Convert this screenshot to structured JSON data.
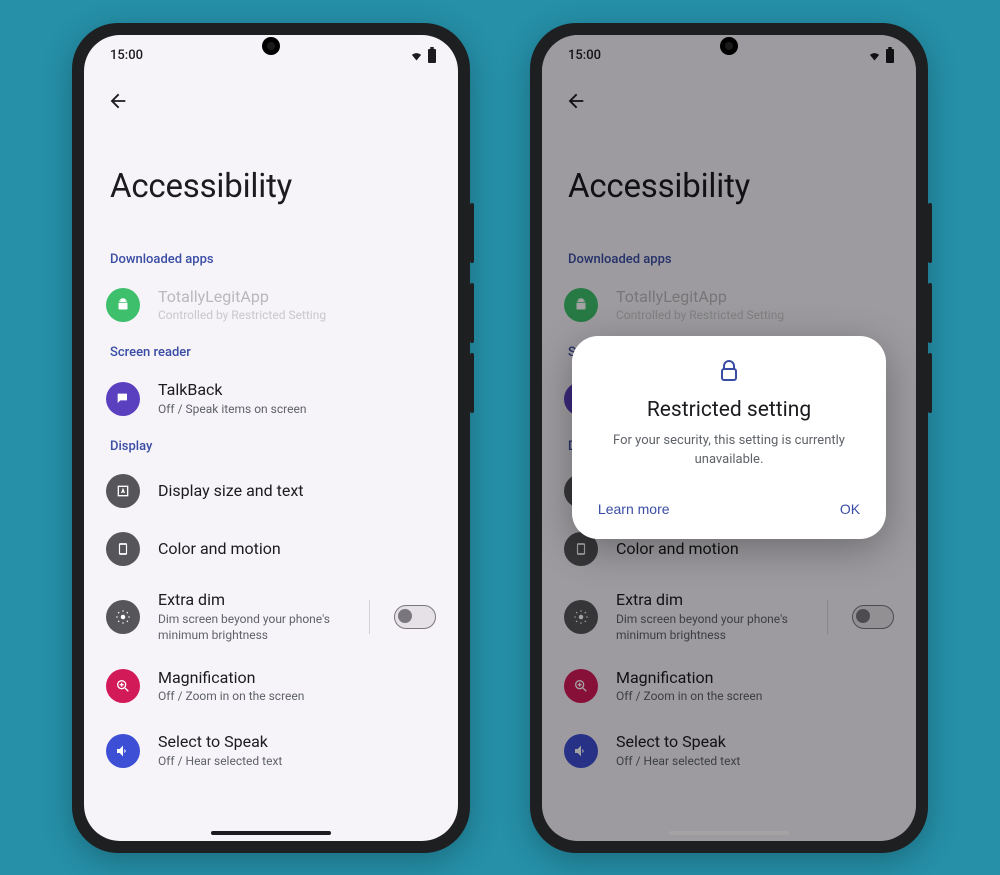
{
  "statusbar": {
    "time": "15:00"
  },
  "page": {
    "title": "Accessibility"
  },
  "sections": {
    "downloaded": {
      "header": "Downloaded apps",
      "app": {
        "title": "TotallyLegitApp",
        "subtitle": "Controlled by Restricted Setting"
      }
    },
    "screenreader": {
      "header": "Screen reader",
      "talkback": {
        "title": "TalkBack",
        "subtitle": "Off / Speak items on screen"
      }
    },
    "display": {
      "header": "Display",
      "size": {
        "title": "Display size and text"
      },
      "color": {
        "title": "Color and motion"
      },
      "extradim": {
        "title": "Extra dim",
        "subtitle": "Dim screen beyond your phone's minimum brightness"
      },
      "magnification": {
        "title": "Magnification",
        "subtitle": "Off / Zoom in on the screen"
      },
      "selectspeak": {
        "title": "Select to Speak",
        "subtitle": "Off / Hear selected text"
      }
    }
  },
  "dialog": {
    "title": "Restricted setting",
    "body": "For your security, this setting is currently unavailable.",
    "learn": "Learn more",
    "ok": "OK"
  }
}
